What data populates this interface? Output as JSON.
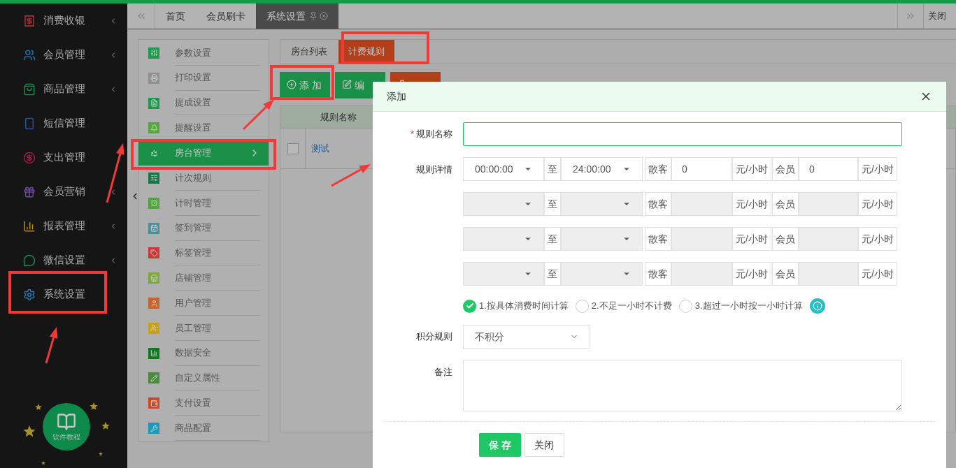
{
  "top_tabs": {
    "items": [
      {
        "label": "首页",
        "selected": false
      },
      {
        "label": "会员刷卡",
        "selected": false
      },
      {
        "label": "系统设置",
        "selected": true
      }
    ],
    "close_ops": "关闭"
  },
  "sidebar": {
    "items": [
      {
        "label": "消费收银",
        "color": "#a03434",
        "submenu": true
      },
      {
        "label": "会员管理",
        "color": "#1f6f9c",
        "submenu": true
      },
      {
        "label": "商品管理",
        "color": "#168a4c",
        "submenu": true
      },
      {
        "label": "短信管理",
        "color": "#2356a0",
        "submenu": false
      },
      {
        "label": "支出管理",
        "color": "#9c1f46",
        "submenu": false
      },
      {
        "label": "会员营销",
        "color": "#6a4aa0",
        "submenu": true
      },
      {
        "label": "报表管理",
        "color": "#b8861a",
        "submenu": true
      },
      {
        "label": "微信设置",
        "color": "#17894a",
        "submenu": true
      },
      {
        "label": "系统设置",
        "color": "#2a7ab8",
        "submenu": false
      }
    ],
    "tutorial": "软件教程"
  },
  "settings_menu": {
    "items": [
      {
        "label": "参数设置",
        "color": "#1c9a4e",
        "selected": false
      },
      {
        "label": "打印设置",
        "color": "#8f8f8f",
        "selected": false
      },
      {
        "label": "提成设置",
        "color": "#1c9a4e",
        "selected": false
      },
      {
        "label": "提醒设置",
        "color": "#56a83a",
        "selected": false
      },
      {
        "label": "房台管理",
        "color": "#1a8f48",
        "selected": true
      },
      {
        "label": "计次规则",
        "color": "#137a47",
        "selected": false
      },
      {
        "label": "计时管理",
        "color": "#4fa53a",
        "selected": false
      },
      {
        "label": "签到管理",
        "color": "#4a8f9a",
        "selected": false
      },
      {
        "label": "标签管理",
        "color": "#c83a3a",
        "selected": false
      },
      {
        "label": "店铺管理",
        "color": "#7aa83a",
        "selected": false
      },
      {
        "label": "用户管理",
        "color": "#c8642a",
        "selected": false
      },
      {
        "label": "员工管理",
        "color": "#c8a01a",
        "selected": false
      },
      {
        "label": "数据安全",
        "color": "#0e7a1e",
        "selected": false
      },
      {
        "label": "自定义属性",
        "color": "#4a8a3a",
        "selected": false
      },
      {
        "label": "支付设置",
        "color": "#c84a2a",
        "selected": false
      },
      {
        "label": "商品配置",
        "color": "#1a9ab8",
        "selected": false
      }
    ]
  },
  "content_tabs": [
    {
      "label": "房台列表",
      "selected": false
    },
    {
      "label": "计费规则",
      "selected": true
    }
  ],
  "toolbar": [
    {
      "kind": "add",
      "label": "添 加"
    },
    {
      "kind": "edit",
      "label": "编"
    },
    {
      "kind": "delete"
    }
  ],
  "table": {
    "columns": [
      "规则名称"
    ],
    "rows": [
      {
        "name": "测试",
        "checked": false
      }
    ]
  },
  "modal": {
    "title": "添加",
    "name_field": {
      "label": "规则名称",
      "required_mark": "*"
    },
    "details": {
      "label": "规则详情",
      "rows": [
        {
          "start": "00:00:00",
          "to": "至",
          "end": "24:00:00",
          "guest": "散客",
          "guest_price": "0",
          "unit": "元/小时",
          "member": "会员",
          "member_price": "0",
          "member_unit": "元/小时",
          "disabled": false
        },
        {
          "to": "至",
          "guest": "散客",
          "unit": "元/小时",
          "member": "会员",
          "member_unit": "元/小时",
          "disabled": true
        },
        {
          "to": "至",
          "guest": "散客",
          "unit": "元/小时",
          "member": "会员",
          "member_unit": "元/小时",
          "disabled": true
        },
        {
          "to": "至",
          "guest": "散客",
          "unit": "元/小时",
          "member": "会员",
          "member_unit": "元/小时",
          "disabled": true
        }
      ]
    },
    "billing_modes": [
      {
        "label": "1.按具体消费时间计算",
        "selected": true
      },
      {
        "label": "2.不足一小时不计费",
        "selected": false
      },
      {
        "label": "3.超过一小时按一小时计算",
        "selected": false
      }
    ],
    "points": {
      "label": "积分规则",
      "value": "不积分"
    },
    "remark": {
      "label": "备注"
    },
    "buttons": [
      {
        "kind": "save",
        "label": "保 存"
      },
      {
        "kind": "close",
        "label": "关闭"
      }
    ]
  }
}
